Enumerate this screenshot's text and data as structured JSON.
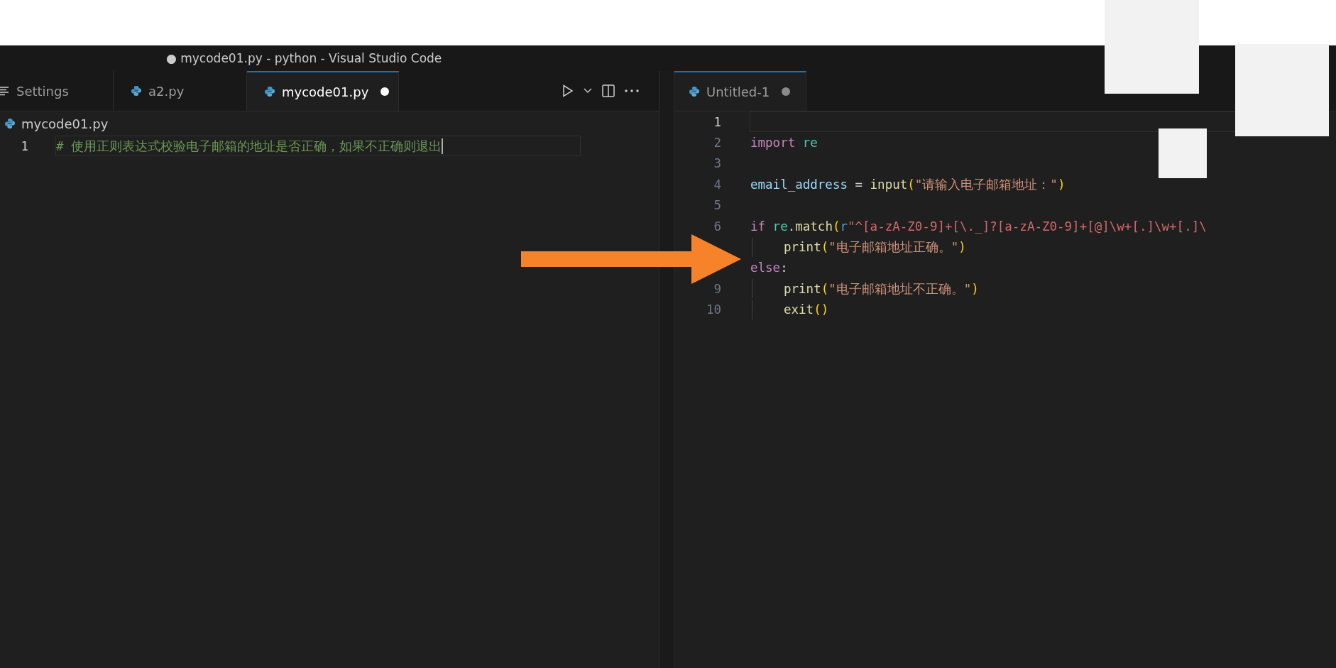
{
  "window": {
    "title": "● mycode01.py - python - Visual Studio Code"
  },
  "left_editor": {
    "tabs": [
      {
        "label": "Settings",
        "kind": "settings",
        "selected": false,
        "modified": false
      },
      {
        "label": "a2.py",
        "kind": "file",
        "selected": false,
        "modified": false
      },
      {
        "label": "mycode01.py",
        "kind": "file",
        "selected": true,
        "modified": true
      }
    ],
    "breadcrumb": "mycode01.py",
    "lines": [
      {
        "number": "1",
        "current": true,
        "indented": false,
        "tokens": [
          {
            "kind": "comment",
            "text": "# 使用正则表达式校验电子邮箱的地址是否正确，如果不正确则退出"
          }
        ]
      }
    ]
  },
  "right_editor": {
    "tabs": [
      {
        "label": "Untitled-1",
        "kind": "file",
        "selected": true,
        "modified": true
      }
    ],
    "lines": [
      {
        "number": "1",
        "current": true,
        "indented": false
      },
      {
        "number": "2",
        "current": false,
        "indented": false,
        "tokens": [
          {
            "kind": "keyword",
            "text": "import"
          },
          {
            "kind": "module",
            "text": " re"
          }
        ]
      },
      {
        "number": "3",
        "current": false,
        "indented": false
      },
      {
        "number": "4",
        "current": false,
        "indented": false,
        "tokens": [
          {
            "kind": "variable",
            "text": "email_address"
          },
          {
            "kind": "plain",
            "text": " = "
          },
          {
            "kind": "function",
            "text": "input"
          },
          {
            "kind": "bracket",
            "text": "("
          },
          {
            "kind": "string",
            "text": "\"请输入电子邮箱地址：\""
          },
          {
            "kind": "bracket",
            "text": ")"
          }
        ]
      },
      {
        "number": "5",
        "current": false,
        "indented": false
      },
      {
        "number": "6",
        "current": false,
        "indented": false,
        "tokens": [
          {
            "kind": "keyword",
            "text": "if"
          },
          {
            "kind": "module",
            "text": " re"
          },
          {
            "kind": "plain",
            "text": "."
          },
          {
            "kind": "function",
            "text": "match"
          },
          {
            "kind": "bracket",
            "text": "("
          },
          {
            "kind": "prefix",
            "text": "r"
          },
          {
            "kind": "regex",
            "text": "\"^[a-zA-Z0-9]+[\\._]?[a-zA-Z0-9]+[@]\\w+[.]\\w+[.]\\"
          }
        ]
      },
      {
        "current": false,
        "indented": true,
        "tokens": [
          {
            "kind": "function",
            "text": "print"
          },
          {
            "kind": "bracket",
            "text": "("
          },
          {
            "kind": "string",
            "text": "\"电子邮箱地址正确。\""
          },
          {
            "kind": "bracket",
            "text": ")"
          }
        ]
      },
      {
        "current": false,
        "indented": false,
        "tokens": [
          {
            "kind": "keyword",
            "text": "else"
          },
          {
            "kind": "plain",
            "text": ":"
          }
        ]
      },
      {
        "number": "9",
        "current": false,
        "indented": true,
        "tokens": [
          {
            "kind": "function",
            "text": "print"
          },
          {
            "kind": "bracket",
            "text": "("
          },
          {
            "kind": "string",
            "text": "\"电子邮箱地址不正确。\""
          },
          {
            "kind": "bracket",
            "text": ")"
          }
        ]
      },
      {
        "number": "10",
        "current": false,
        "indented": true,
        "tokens": [
          {
            "kind": "function",
            "text": "exit"
          },
          {
            "kind": "bracket",
            "text": "()"
          }
        ]
      }
    ]
  }
}
